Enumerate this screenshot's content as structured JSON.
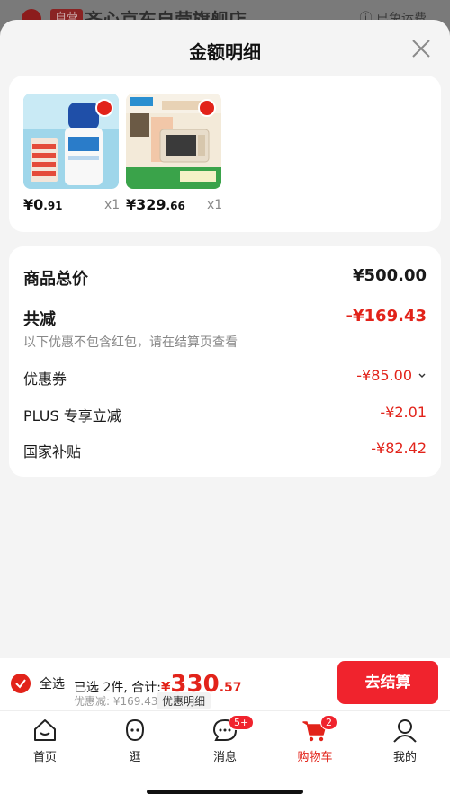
{
  "background": {
    "store_tag": "自营",
    "store_name": "齐心京东自营旗舰店",
    "shipping": "已免运费"
  },
  "sheet": {
    "title": "金额明细"
  },
  "products": [
    {
      "price_main": "¥0",
      "price_dec": ".91",
      "qty": "x1"
    },
    {
      "price_main": "¥329",
      "price_dec": ".66",
      "qty": "x1"
    }
  ],
  "detail": {
    "goods_total_label": "商品总价",
    "goods_total_amount": "¥500.00",
    "total_discount_label": "共减",
    "total_discount_amount": "-¥169.43",
    "note": "以下优惠不包含红包，请在结算页查看",
    "items": [
      {
        "label": "优惠券",
        "amount": "-¥85.00"
      },
      {
        "label": "PLUS 专享立减",
        "amount": "-¥2.01"
      },
      {
        "label": "国家补贴",
        "amount": "-¥82.42"
      }
    ]
  },
  "checkout": {
    "select_all": "全选",
    "selected_text": "已选 2件, 合计:",
    "total_yen": "¥",
    "total_int": "330",
    "total_dec": ".57",
    "discount_text": "优惠减: ¥169.43",
    "detail_button": "优惠明细",
    "pay_button": "去结算"
  },
  "tabbar": {
    "items": [
      {
        "label": "首页",
        "icon": "home-icon"
      },
      {
        "label": "逛",
        "icon": "browse-face-icon"
      },
      {
        "label": "消息",
        "icon": "message-icon",
        "badge": "5+"
      },
      {
        "label": "购物车",
        "icon": "cart-icon",
        "badge": "2",
        "active": true
      },
      {
        "label": "我的",
        "icon": "profile-icon"
      }
    ]
  },
  "colors": {
    "accent": "#e2231a",
    "pay_button": "#f0232d"
  }
}
